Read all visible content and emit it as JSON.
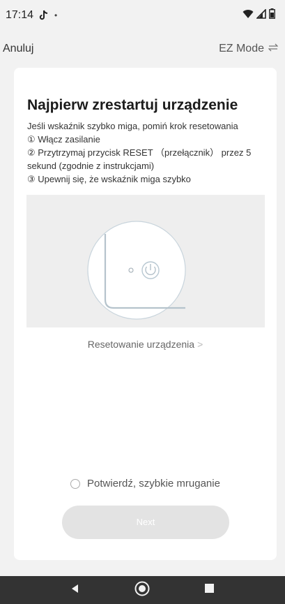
{
  "status_bar": {
    "time": "17:14",
    "dot": "•"
  },
  "header": {
    "cancel_label": "Anuluj",
    "mode_label": "EZ Mode"
  },
  "card": {
    "title": "Najpierw zrestartuj urządzenie",
    "instructions": [
      "Jeśli wskaźnik szybko miga, pomiń krok resetowania",
      "① Włącz zasilanie",
      "② Przytrzymaj przycisk RESET （przełącznik） przez 5 sekund (zgodnie z instrukcjami)",
      "③ Upewnij się, że wskaźnik miga szybko"
    ],
    "reset_link": "Resetowanie urządzenia",
    "reset_chevron": ">",
    "confirm_label": "Potwierdź, szybkie mruganie",
    "next_label": "Next"
  },
  "colors": {
    "background": "#f2f2f2",
    "card": "#ffffff",
    "next_button_disabled": "#e3e3e3",
    "nav_bar": "#333333"
  }
}
